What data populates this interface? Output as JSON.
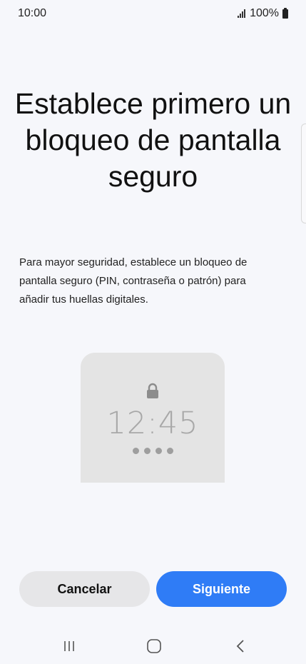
{
  "status_bar": {
    "time": "10:00",
    "battery_percent": "100%",
    "icons": [
      "signal-icon",
      "battery-icon"
    ]
  },
  "screen": {
    "title": "Establece primero un bloqueo de pantalla seguro",
    "description": "Para mayor seguridad, establece un bloqueo de pantalla seguro (PIN, contraseña o patrón) para añadir tus huellas digitales."
  },
  "preview": {
    "time": "12:45",
    "icon": "lock-icon",
    "pin_dot_count": 4
  },
  "actions": {
    "cancel_label": "Cancelar",
    "next_label": "Siguiente"
  },
  "nav": {
    "recent_icon": "recent-apps-icon",
    "home_icon": "home-icon",
    "back_icon": "back-icon"
  },
  "colors": {
    "background": "#f6f7fb",
    "accent": "#2f7cf6",
    "secondary_button": "#e6e6e8",
    "preview_bg": "#e4e4e4"
  }
}
